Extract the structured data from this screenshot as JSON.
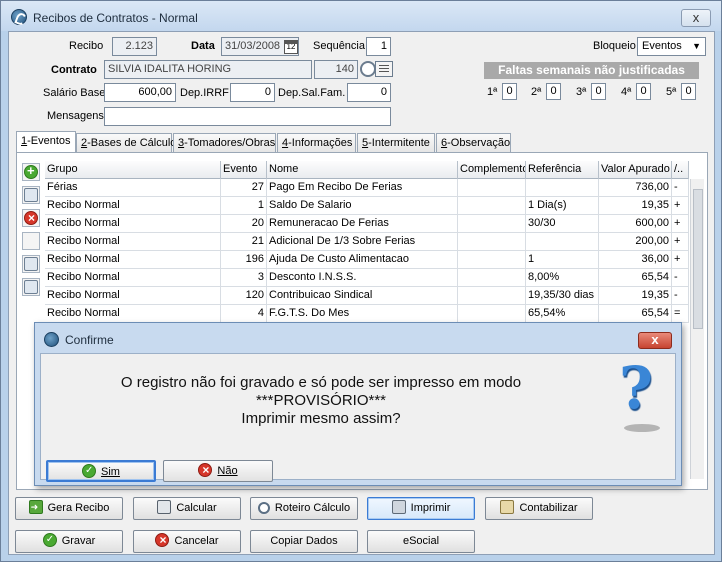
{
  "window": {
    "title": "Recibos de Contratos - Normal",
    "close_label": "x"
  },
  "form": {
    "recibo_label": "Recibo",
    "recibo_value": "2.123",
    "data_label": "Data",
    "data_value": "31/03/2008",
    "sequencia_label": "Sequência",
    "sequencia_value": "1",
    "bloqueio_label": "Bloqueio",
    "bloqueio_value": "Eventos",
    "contrato_label": "Contrato",
    "contrato_value": "SILVIA IDALITA HORING",
    "contrato_code": "140",
    "salario_label": "Salário Base",
    "salario_value": "600,00",
    "depirrf_label": "Dep.IRRF",
    "depirrf_value": "0",
    "depsal_label": "Dep.Sal.Fam.",
    "depsal_value": "0",
    "mensagens_label": "Mensagens",
    "mensagens_value": ""
  },
  "faltas": {
    "header": "Faltas semanais não justificadas",
    "weeks": [
      {
        "label": "1ª",
        "value": "0"
      },
      {
        "label": "2ª",
        "value": "0"
      },
      {
        "label": "3ª",
        "value": "0"
      },
      {
        "label": "4ª",
        "value": "0"
      },
      {
        "label": "5ª",
        "value": "0"
      }
    ]
  },
  "tabs": [
    {
      "key": "1",
      "label": "-Eventos"
    },
    {
      "key": "2",
      "label": "-Bases de Cálculo"
    },
    {
      "key": "3",
      "label": "-Tomadores/Obras"
    },
    {
      "key": "4",
      "label": "-Informações"
    },
    {
      "key": "5",
      "label": "-Intermitente"
    },
    {
      "key": "6",
      "label": "-Observação"
    }
  ],
  "grid": {
    "columns": [
      "Grupo",
      "Evento",
      "Nome",
      "Complemento",
      "Referência",
      "Valor Apurado",
      "/.."
    ],
    "rows": [
      [
        "Férias",
        "27",
        "Pago Em Recibo De Ferias",
        "",
        "",
        "736,00",
        "-"
      ],
      [
        "Recibo Normal",
        "1",
        "Saldo De Salario",
        "",
        "1 Dia(s)",
        "19,35",
        "+"
      ],
      [
        "Recibo Normal",
        "20",
        "Remuneracao De Ferias",
        "",
        "30/30",
        "600,00",
        "+"
      ],
      [
        "Recibo Normal",
        "21",
        "Adicional De 1/3 Sobre Ferias",
        "",
        "",
        "200,00",
        "+"
      ],
      [
        "Recibo Normal",
        "196",
        "Ajuda De Custo Alimentacao",
        "",
        "1",
        "36,00",
        "+"
      ],
      [
        "Recibo Normal",
        "3",
        "Desconto I.N.S.S.",
        "",
        "8,00%",
        "65,54",
        "-"
      ],
      [
        "Recibo Normal",
        "120",
        "Contribuicao Sindical",
        "",
        "19,35/30 dias",
        "19,35",
        "-"
      ],
      [
        "Recibo Normal",
        "4",
        "F.G.T.S. Do Mes",
        "",
        "65,54%",
        "65,54",
        "="
      ]
    ]
  },
  "dialog": {
    "title": "Confirme",
    "close_label": "x",
    "line1": "O registro não foi gravado e só pode ser impresso em modo",
    "line2": "***PROVISÓRIO***",
    "line3": "Imprimir mesmo assim?",
    "yes_label": "Sim",
    "no_label": "Não"
  },
  "buttons": {
    "gera_recibo": "Gera Recibo",
    "calcular": "Calcular",
    "roteiro": "Roteiro Cálculo",
    "imprimir": "Imprimir",
    "contabilizar": "Contabilizar",
    "gravar": "Gravar",
    "cancelar": "Cancelar",
    "copiar": "Copiar Dados",
    "esocial": "eSocial"
  }
}
